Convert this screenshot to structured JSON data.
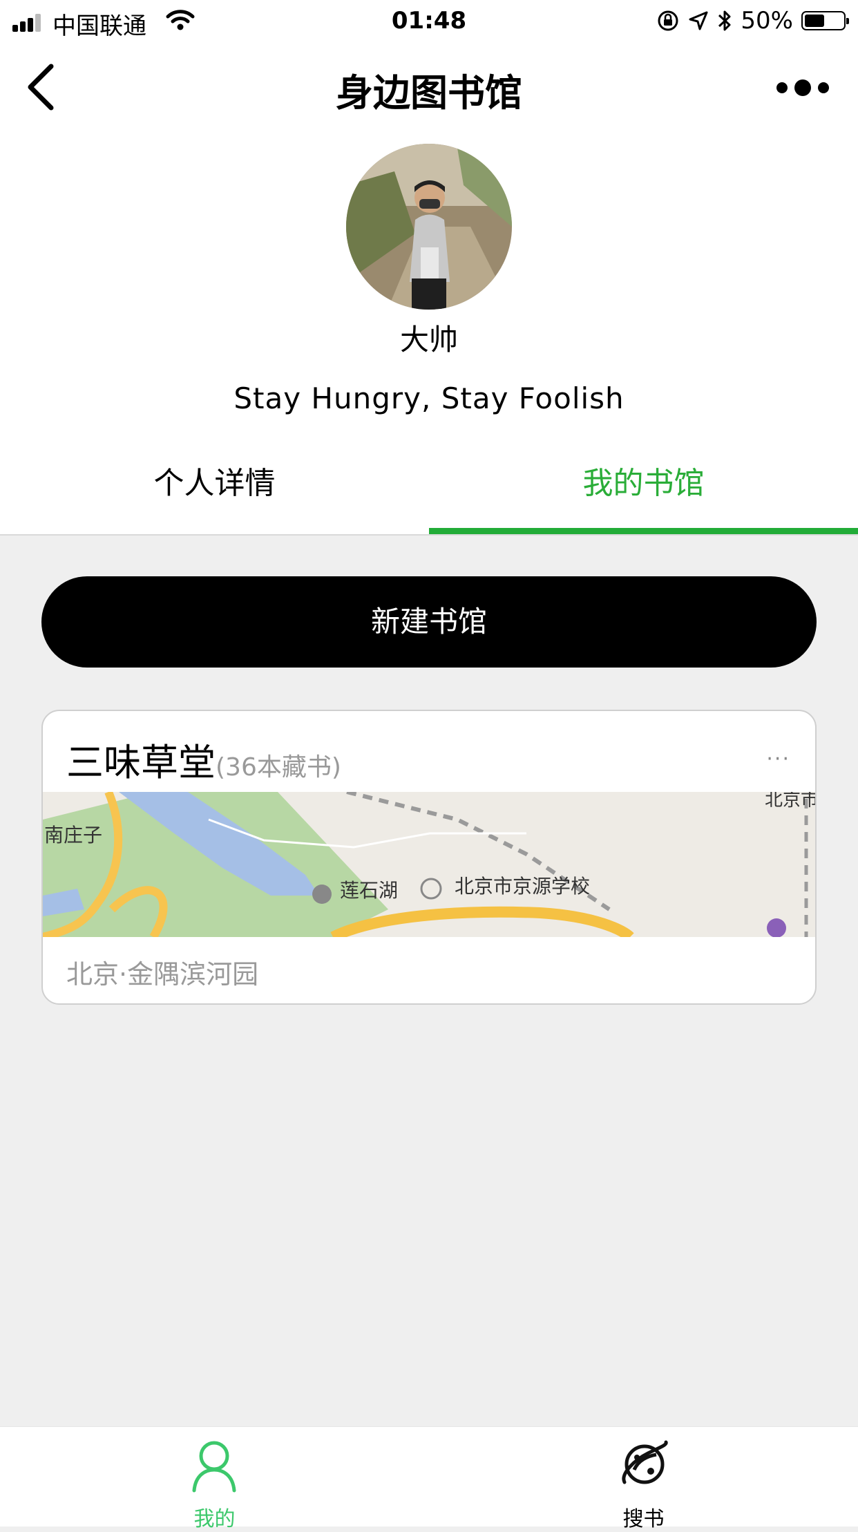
{
  "status_bar": {
    "carrier": "中国联通",
    "time": "01:48",
    "battery_percent": "50%",
    "battery_level": 0.5,
    "icons": [
      "signal-icon",
      "wifi-icon",
      "rotation-lock-icon",
      "location-icon",
      "bluetooth-icon",
      "battery-icon"
    ]
  },
  "nav": {
    "title": "身边图书馆",
    "back_icon": "chevron-left-icon",
    "more_icon": "more-dots-icon"
  },
  "profile": {
    "name": "大帅",
    "motto": "Stay Hungry, Stay Foolish"
  },
  "tabs": [
    {
      "label": "个人详情",
      "active": false
    },
    {
      "label": "我的书馆",
      "active": true
    }
  ],
  "new_library_button": "新建书馆",
  "libraries": [
    {
      "name": "三味草堂",
      "count": "(36本藏书)",
      "more": "···",
      "address": "北京·金隅滨河园",
      "map_labels": {
        "nanzhuangzi": "南庄子",
        "lianshihu": "莲石湖",
        "school": "北京市京源学校",
        "corner": "北京市"
      }
    }
  ],
  "bottom_tabs": [
    {
      "label": "我的",
      "icon": "user-icon",
      "active": true
    },
    {
      "label": "搜书",
      "icon": "planet-icon",
      "active": false
    }
  ],
  "colors": {
    "accent_green": "#22ac38",
    "tab_active_text": "#2aad38",
    "bottom_active": "#3cc86b",
    "button_bg": "#000000"
  }
}
